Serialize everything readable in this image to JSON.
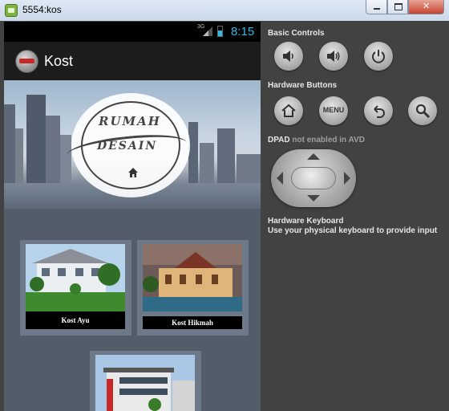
{
  "window": {
    "title": "5554:kos",
    "app_icon": "android-emulator-icon"
  },
  "statusbar": {
    "network": "3G",
    "time": "8:15",
    "accent": "#33b5e5"
  },
  "actionbar": {
    "title": "Kost",
    "logo_icon": "app-logo-icon"
  },
  "banner": {
    "line1": "RUMAH",
    "line2": "DESAIN"
  },
  "listings": [
    {
      "label": "Kost Ayu"
    },
    {
      "label": "Kost Hikmah"
    },
    {
      "label": ""
    }
  ],
  "controls": {
    "basic_title": "Basic Controls",
    "hardware_title": "Hardware Buttons",
    "menu_label": "MENU",
    "dpad_title": "DPAD",
    "dpad_note": "not enabled in AVD",
    "keyboard_title": "Hardware Keyboard",
    "keyboard_note": "Use your physical keyboard to provide input"
  }
}
